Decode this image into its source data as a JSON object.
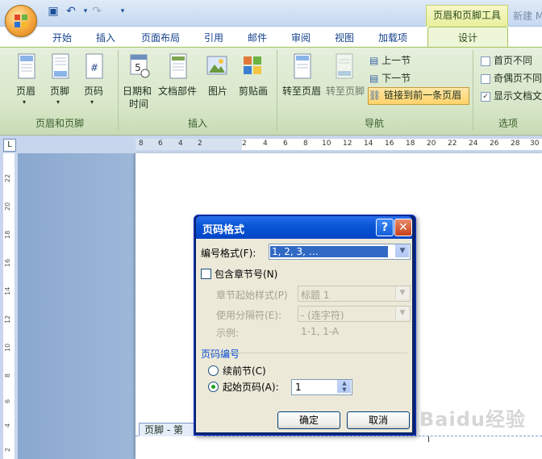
{
  "window": {
    "context_tab_header": "页眉和页脚工具",
    "doc_title": "新建 M"
  },
  "tabs": [
    "开始",
    "插入",
    "页面布局",
    "引用",
    "邮件",
    "审阅",
    "视图",
    "加载项"
  ],
  "active_tab": "设计",
  "ribbon": {
    "groups": {
      "header_footer": {
        "label": "页眉和页脚",
        "header": "页眉",
        "footer": "页脚",
        "page_number": "页码"
      },
      "insert": {
        "label": "插入",
        "date_time_1": "日期和",
        "date_time_2": "时间",
        "quick_parts": "文档部件",
        "picture": "图片",
        "clip_art": "剪贴画"
      },
      "navigation": {
        "label": "导航",
        "goto_header": "转至页眉",
        "goto_footer": "转至页脚",
        "prev_section": "上一节",
        "next_section": "下一节",
        "link_to_previous": "链接到前一条页眉"
      },
      "options": {
        "label": "选项",
        "different_first": "首页不同",
        "different_odd_even": "奇偶页不同",
        "show_doc_text": "显示文档文"
      }
    }
  },
  "ruler": {
    "h_ticks": [
      "8",
      "6",
      "4",
      "2",
      "2",
      "4",
      "6",
      "8",
      "10",
      "12",
      "14",
      "16",
      "18",
      "20",
      "22",
      "24",
      "26",
      "28",
      "30"
    ],
    "v_ticks": [
      "22",
      "20",
      "18",
      "16",
      "14",
      "12",
      "10",
      "8",
      "6",
      "4",
      "2"
    ],
    "corner": "L"
  },
  "document": {
    "footer_tag": "页脚 - 第",
    "watermark": "Baidu经验"
  },
  "dialog": {
    "title": "页码格式",
    "help": "?",
    "close": "✕",
    "number_format_label": "编号格式(F):",
    "number_format_value": "1, 2, 3, …",
    "include_chapter_label": "包含章节号(N)",
    "chapter_style_label": "章节起始样式(P)",
    "chapter_style_value": "标题 1",
    "separator_label": "使用分隔符(E):",
    "separator_value": "-   (连字符)",
    "example_label": "示例:",
    "example_value": "1-1, 1-A",
    "numbering_section": "页码编号",
    "continue_label": "续前节(C)",
    "start_at_label": "起始页码(A):",
    "start_at_value": "1",
    "ok": "确定",
    "cancel": "取消"
  }
}
